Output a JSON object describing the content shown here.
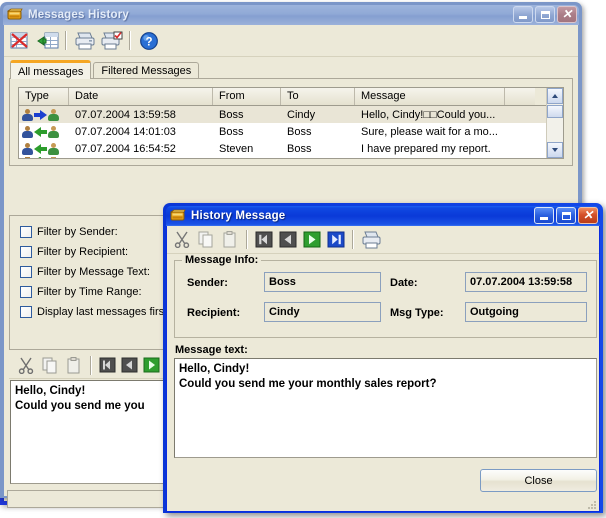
{
  "main_window": {
    "title": "Messages History",
    "icon": "history-log-icon",
    "state": "inactive",
    "controls": {
      "minimize": "Minimize",
      "maximize": "Maximize",
      "close": "Close"
    },
    "toolbar": [
      {
        "name": "clear-history-button",
        "icon": "grid-delete-icon",
        "tooltip": "Clear History"
      },
      {
        "name": "export-history-button",
        "icon": "export-grid-icon",
        "tooltip": "Export"
      },
      {
        "name": "print-button",
        "icon": "printer-icon",
        "tooltip": "Print"
      },
      {
        "name": "print-selected-button",
        "icon": "printer-check-icon",
        "tooltip": "Print Selected"
      },
      {
        "name": "help-button",
        "icon": "help-question-icon",
        "tooltip": "Help"
      }
    ],
    "tabs": [
      {
        "label": "All messages",
        "selected": true
      },
      {
        "label": "Filtered Messages",
        "selected": false
      }
    ],
    "grid": {
      "columns": [
        "Type",
        "Date",
        "From",
        "To",
        "Message"
      ],
      "rows": [
        {
          "type_icon": "outgoing-arrow-icon",
          "direction": "outgoing",
          "date": "07.07.2004 13:59:58",
          "from": "Boss",
          "to": "Cindy",
          "message": "Hello, Cindy!□□Could you...",
          "selected": true
        },
        {
          "type_icon": "incoming-arrow-icon",
          "direction": "incoming",
          "date": "07.07.2004 14:01:03",
          "from": "Boss",
          "to": "Boss",
          "message": "Sure, please wait for a mo...",
          "selected": false
        },
        {
          "type_icon": "incoming-arrow-icon",
          "direction": "incoming",
          "date": "07.07.2004 16:54:52",
          "from": "Steven",
          "to": "Boss",
          "message": "I have prepared my report.",
          "selected": false
        }
      ]
    },
    "filters": [
      {
        "label": "Filter by Sender:",
        "checked": false
      },
      {
        "label": "Filter by Recipient:",
        "checked": false
      },
      {
        "label": "Filter by Message Text:",
        "checked": false
      },
      {
        "label": "Filter by Time Range:",
        "checked": false
      },
      {
        "label": "Display last messages first",
        "checked": false
      }
    ],
    "preview_toolbar": [
      {
        "name": "cut-button",
        "icon": "scissors-icon"
      },
      {
        "name": "copy-button",
        "icon": "copy-icon"
      },
      {
        "name": "paste-button",
        "icon": "paste-icon"
      },
      {
        "name": "first-button",
        "icon": "first-record-icon"
      },
      {
        "name": "prev-button",
        "icon": "prev-record-icon"
      },
      {
        "name": "next-button",
        "icon": "next-record-icon"
      }
    ],
    "preview_text": "Hello, Cindy!\nCould you send me you"
  },
  "dialog": {
    "title": "History Message",
    "icon": "history-log-icon",
    "state": "active",
    "controls": {
      "minimize": "Minimize",
      "maximize": "Maximize",
      "close": "Close"
    },
    "toolbar": [
      {
        "name": "cut-button",
        "icon": "scissors-icon",
        "enabled": false
      },
      {
        "name": "copy-button",
        "icon": "copy-icon",
        "enabled": false
      },
      {
        "name": "paste-button",
        "icon": "paste-icon",
        "enabled": false
      },
      {
        "name": "first-record-button",
        "icon": "first-record-icon",
        "enabled": false
      },
      {
        "name": "prev-record-button",
        "icon": "prev-record-icon",
        "enabled": false
      },
      {
        "name": "next-record-button",
        "icon": "next-record-icon",
        "enabled": true
      },
      {
        "name": "last-record-button",
        "icon": "last-record-icon",
        "enabled": true
      },
      {
        "name": "print-button",
        "icon": "printer-icon",
        "enabled": true
      }
    ],
    "message_info": {
      "group_label": "Message Info:",
      "sender_label": "Sender:",
      "sender_value": "Boss",
      "date_label": "Date:",
      "date_value": "07.07.2004 13:59:58",
      "recipient_label": "Recipient:",
      "recipient_value": "Cindy",
      "msgtype_label": "Msg Type:",
      "msgtype_value": "Outgoing"
    },
    "message_text_label": "Message text:",
    "message_text": "Hello, Cindy!\nCould you send me your monthly sales report?",
    "close_button": "Close"
  },
  "colors": {
    "active_title": "#0a2ce0",
    "inactive_title": "#90a9d6",
    "face": "#ece9d8",
    "selected_tab_accent": "#f5a623",
    "outgoing_arrow": "#1b3fd0",
    "incoming_arrow": "#2c9d2c"
  }
}
